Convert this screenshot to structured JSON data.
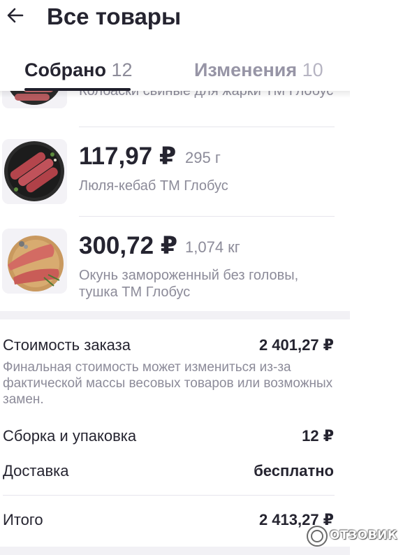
{
  "header": {
    "title": "Все товары",
    "back_icon": "arrow-left-icon"
  },
  "tabs": [
    {
      "label": "Собрано",
      "count": "12"
    },
    {
      "label": "Изменения",
      "count": "10"
    }
  ],
  "items": [
    {
      "price": "",
      "weight": "",
      "name": "Колбаски свиные для жарки ТМ Глобус"
    },
    {
      "price": "117,97 ₽",
      "weight": "295 г",
      "name": "Люля-кебаб ТМ Глобус"
    },
    {
      "price": "300,72 ₽",
      "weight": "1,074 кг",
      "name": "Окунь замороженный без головы, тушка ТМ Глобус"
    }
  ],
  "summary": {
    "order_cost_label": "Стоимость заказа",
    "order_cost_value": "2 401,27 ₽",
    "note": "Финальная стоимость может измениться из-за фактической массы весовых товаров или возможных замен.",
    "assembly_label": "Сборка и упаковка",
    "assembly_value": "12 ₽",
    "delivery_label": "Доставка",
    "delivery_value": "бесплатно",
    "total_label": "Итого",
    "total_value": "2 413,27 ₽"
  },
  "watermark": {
    "text": "ОТЗОВИК"
  }
}
